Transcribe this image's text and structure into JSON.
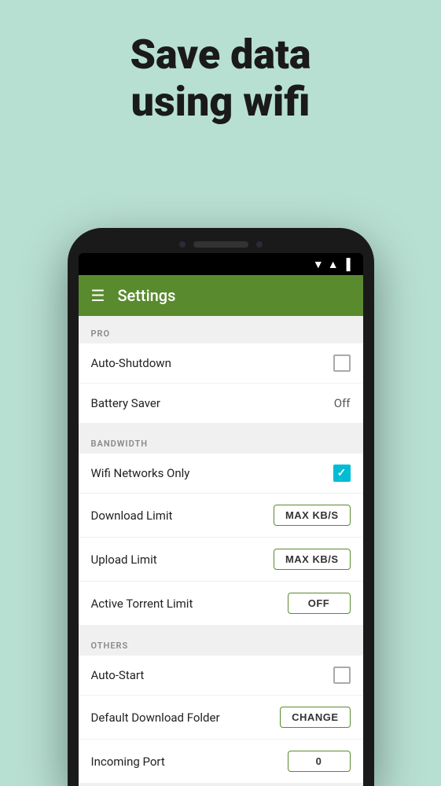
{
  "hero": {
    "line1": "Save data",
    "line2": "using wifi"
  },
  "app_bar": {
    "title": "Settings"
  },
  "sections": [
    {
      "id": "pro",
      "header": "PRO",
      "rows": [
        {
          "id": "auto-shutdown",
          "label": "Auto-Shutdown",
          "control": "checkbox",
          "value": false
        },
        {
          "id": "battery-saver",
          "label": "Battery Saver",
          "control": "text",
          "value": "Off"
        }
      ]
    },
    {
      "id": "bandwidth",
      "header": "BANDWIDTH",
      "rows": [
        {
          "id": "wifi-networks",
          "label": "Wifi Networks Only",
          "control": "checkbox-checked",
          "value": true
        },
        {
          "id": "download-limit",
          "label": "Download Limit",
          "control": "button",
          "value": "MAX KB/S"
        },
        {
          "id": "upload-limit",
          "label": "Upload Limit",
          "control": "button",
          "value": "MAX KB/S"
        },
        {
          "id": "active-torrent",
          "label": "Active Torrent Limit",
          "control": "button",
          "value": "OFF"
        }
      ]
    },
    {
      "id": "others",
      "header": "OTHERS",
      "rows": [
        {
          "id": "auto-start",
          "label": "Auto-Start",
          "control": "checkbox",
          "value": false
        },
        {
          "id": "default-download-folder",
          "label": "Default Download Folder",
          "control": "button",
          "value": "CHANGE"
        },
        {
          "id": "incoming-port",
          "label": "Incoming Port",
          "control": "button",
          "value": "0"
        }
      ]
    }
  ]
}
